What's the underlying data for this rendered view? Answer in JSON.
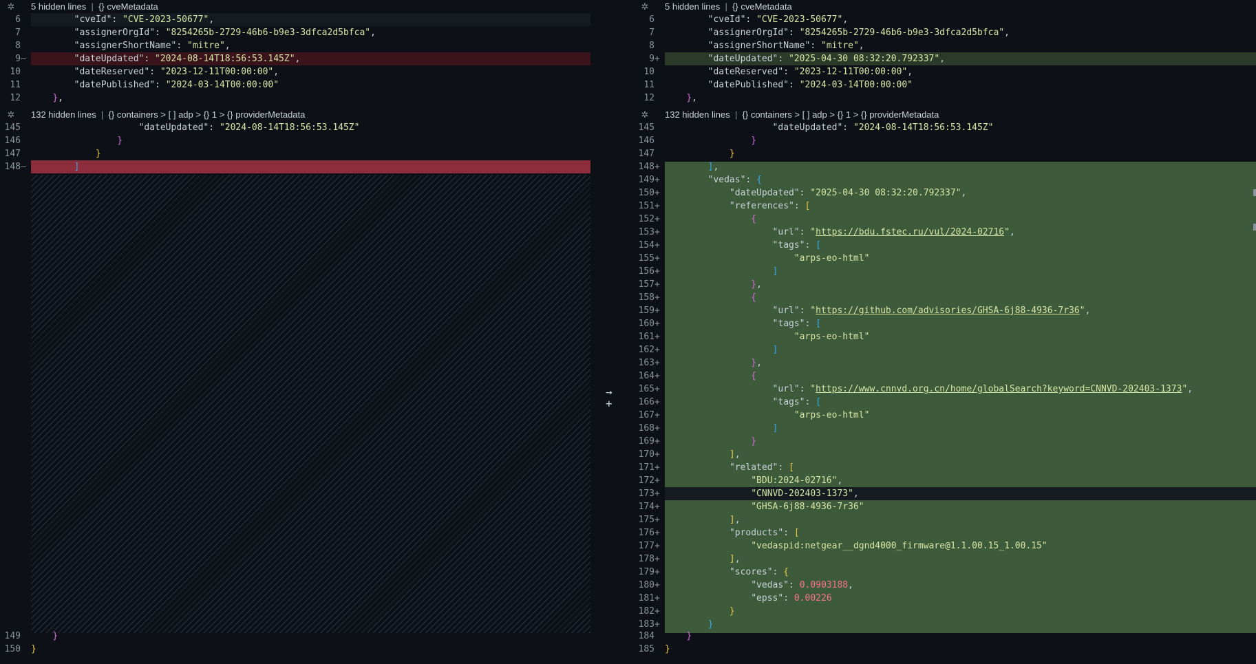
{
  "left": {
    "folds": [
      {
        "hidden": "5 hidden lines",
        "crumbs": "{} cveMetadata"
      },
      {
        "hidden": "132 hidden lines",
        "crumbs": "{} containers > [ ] adp > {} 1 > {} providerMetadata"
      }
    ],
    "lines": [
      {
        "n": "6",
        "m": "",
        "t": "        \"cveId\": \"CVE-2023-50677\","
      },
      {
        "n": "7",
        "m": "",
        "t": "        \"assignerOrgId\": \"8254265b-2729-46b6-b9e3-3dfca2d5bfca\","
      },
      {
        "n": "8",
        "m": "",
        "t": "        \"assignerShortName\": \"mitre\","
      },
      {
        "n": "9",
        "m": "—",
        "t": "        \"dateUpdated\": \"2024-08-14T18:56:53.145Z\","
      },
      {
        "n": "10",
        "m": "",
        "t": "        \"dateReserved\": \"2023-12-11T00:00:00\","
      },
      {
        "n": "11",
        "m": "",
        "t": "        \"datePublished\": \"2024-03-14T00:00:00\""
      },
      {
        "n": "12",
        "m": "",
        "t": "    },"
      },
      {
        "n": "145",
        "m": "",
        "t": "                    \"dateUpdated\": \"2024-08-14T18:56:53.145Z\""
      },
      {
        "n": "146",
        "m": "",
        "t": "                }"
      },
      {
        "n": "147",
        "m": "",
        "t": "            }"
      },
      {
        "n": "148",
        "m": "—",
        "t": "        ]"
      },
      {
        "n": "149",
        "m": "",
        "t": "    }"
      },
      {
        "n": "150",
        "m": "",
        "t": "}"
      }
    ]
  },
  "right": {
    "folds": [
      {
        "hidden": "5 hidden lines",
        "crumbs": "{} cveMetadata"
      },
      {
        "hidden": "132 hidden lines",
        "crumbs": "{} containers > [ ] adp > {} 1 > {} providerMetadata"
      }
    ],
    "lines": [
      {
        "n": "6",
        "m": "",
        "t": "        \"cveId\": \"CVE-2023-50677\","
      },
      {
        "n": "7",
        "m": "",
        "t": "        \"assignerOrgId\": \"8254265b-2729-46b6-b9e3-3dfca2d5bfca\","
      },
      {
        "n": "8",
        "m": "",
        "t": "        \"assignerShortName\": \"mitre\","
      },
      {
        "n": "9",
        "m": "+",
        "t": "        \"dateUpdated\": \"2025-04-30 08:32:20.792337\","
      },
      {
        "n": "10",
        "m": "",
        "t": "        \"dateReserved\": \"2023-12-11T00:00:00\","
      },
      {
        "n": "11",
        "m": "",
        "t": "        \"datePublished\": \"2024-03-14T00:00:00\""
      },
      {
        "n": "12",
        "m": "",
        "t": "    },"
      },
      {
        "n": "145",
        "m": "",
        "t": "                    \"dateUpdated\": \"2024-08-14T18:56:53.145Z\""
      },
      {
        "n": "146",
        "m": "",
        "t": "                }"
      },
      {
        "n": "147",
        "m": "",
        "t": "            }"
      },
      {
        "n": "148",
        "m": "+",
        "t": "        ],"
      },
      {
        "n": "149",
        "m": "+",
        "t": "        \"vedas\": {"
      },
      {
        "n": "150",
        "m": "+",
        "t": "            \"dateUpdated\": \"2025-04-30 08:32:20.792337\","
      },
      {
        "n": "151",
        "m": "+",
        "t": "            \"references\": ["
      },
      {
        "n": "152",
        "m": "+",
        "t": "                {"
      },
      {
        "n": "153",
        "m": "+",
        "t": "                    \"url\": \"https://bdu.fstec.ru/vul/2024-02716\","
      },
      {
        "n": "154",
        "m": "+",
        "t": "                    \"tags\": ["
      },
      {
        "n": "155",
        "m": "+",
        "t": "                        \"arps-eo-html\""
      },
      {
        "n": "156",
        "m": "+",
        "t": "                    ]"
      },
      {
        "n": "157",
        "m": "+",
        "t": "                },"
      },
      {
        "n": "158",
        "m": "+",
        "t": "                {"
      },
      {
        "n": "159",
        "m": "+",
        "t": "                    \"url\": \"https://github.com/advisories/GHSA-6j88-4936-7r36\","
      },
      {
        "n": "160",
        "m": "+",
        "t": "                    \"tags\": ["
      },
      {
        "n": "161",
        "m": "+",
        "t": "                        \"arps-eo-html\""
      },
      {
        "n": "162",
        "m": "+",
        "t": "                    ]"
      },
      {
        "n": "163",
        "m": "+",
        "t": "                },"
      },
      {
        "n": "164",
        "m": "+",
        "t": "                {"
      },
      {
        "n": "165",
        "m": "+",
        "t": "                    \"url\": \"https://www.cnnvd.org.cn/home/globalSearch?keyword=CNNVD-202403-1373\","
      },
      {
        "n": "166",
        "m": "+",
        "t": "                    \"tags\": ["
      },
      {
        "n": "167",
        "m": "+",
        "t": "                        \"arps-eo-html\""
      },
      {
        "n": "168",
        "m": "+",
        "t": "                    ]"
      },
      {
        "n": "169",
        "m": "+",
        "t": "                }"
      },
      {
        "n": "170",
        "m": "+",
        "t": "            ],"
      },
      {
        "n": "171",
        "m": "+",
        "t": "            \"related\": ["
      },
      {
        "n": "172",
        "m": "+",
        "t": "                \"BDU:2024-02716\","
      },
      {
        "n": "173",
        "m": "+",
        "t": "                \"CNNVD-202403-1373\","
      },
      {
        "n": "174",
        "m": "+",
        "t": "                \"GHSA-6j88-4936-7r36\""
      },
      {
        "n": "175",
        "m": "+",
        "t": "            ],"
      },
      {
        "n": "176",
        "m": "+",
        "t": "            \"products\": ["
      },
      {
        "n": "177",
        "m": "+",
        "t": "                \"vedaspid:netgear__dgnd4000_firmware@1.1.00.15_1.00.15\""
      },
      {
        "n": "178",
        "m": "+",
        "t": "            ],"
      },
      {
        "n": "179",
        "m": "+",
        "t": "            \"scores\": {"
      },
      {
        "n": "180",
        "m": "+",
        "t": "                \"vedas\": 0.0903188,"
      },
      {
        "n": "181",
        "m": "+",
        "t": "                \"epss\": 0.00226"
      },
      {
        "n": "182",
        "m": "+",
        "t": "            }"
      },
      {
        "n": "183",
        "m": "+",
        "t": "        }"
      },
      {
        "n": "184",
        "m": "",
        "t": "    }"
      },
      {
        "n": "185",
        "m": "",
        "t": "}"
      }
    ]
  },
  "center": {
    "arrow_icon": "arrow-right-icon",
    "plus_icon": "plus-icon"
  },
  "colors": {
    "deleted": "#3b141b",
    "added": "#3d5a3b",
    "deleted_strong": "#8b2d3a"
  }
}
